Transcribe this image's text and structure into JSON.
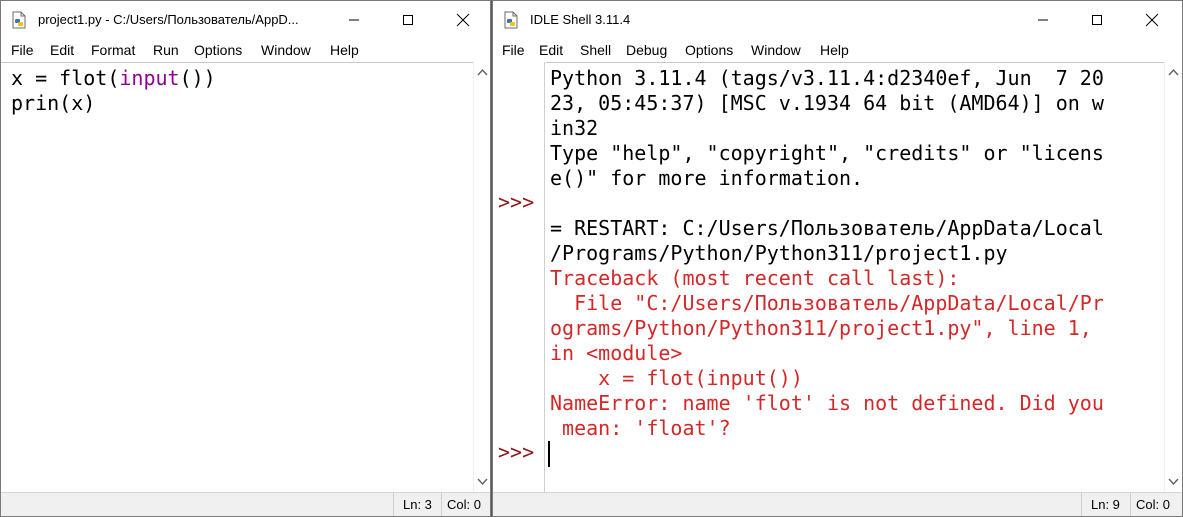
{
  "editor": {
    "title": "project1.py - C:/Users/Пользователь/AppD...",
    "menu": [
      "File",
      "Edit",
      "Format",
      "Run",
      "Options",
      "Window",
      "Help"
    ],
    "code": {
      "line1_a": "x = flot(",
      "line1_b": "input",
      "line1_c": "())",
      "line2": "prin(x)"
    },
    "status": {
      "ln": "Ln: 3",
      "col": "Col: 0"
    }
  },
  "shell": {
    "title": "IDLE Shell 3.11.4",
    "menu": [
      "File",
      "Edit",
      "Shell",
      "Debug",
      "Options",
      "Window",
      "Help"
    ],
    "lines": [
      "Python 3.11.4 (tags/v3.11.4:d2340ef, Jun  7 20",
      "23, 05:45:37) [MSC v.1934 64 bit (AMD64)] on w",
      "in32",
      "Type \"help\", \"copyright\", \"credits\" or \"licens",
      "e()\" for more information.",
      "",
      "= RESTART: C:/Users/Пользователь/AppData/Local",
      "/Programs/Python/Python311/project1.py",
      "Traceback (most recent call last):",
      "  File \"C:/Users/Пользователь/AppData/Local/Pr",
      "ograms/Python/Python311/project1.py\", line 1,",
      "in <module>",
      "    x = flot(input())",
      "NameError: name 'flot' is not defined. Did you",
      " mean: 'float'?"
    ],
    "prompt": ">>>",
    "status": {
      "ln": "Ln: 9",
      "col": "Col: 0"
    }
  },
  "colors": {
    "error_text": "#d42828",
    "prompt": "#8b1a1a",
    "builtin": "#900090"
  },
  "icons": [
    "python-file-icon",
    "python-shell-icon",
    "minimize-icon",
    "maximize-icon",
    "close-icon",
    "scroll-up-arrow-icon",
    "scroll-down-arrow-icon"
  ]
}
